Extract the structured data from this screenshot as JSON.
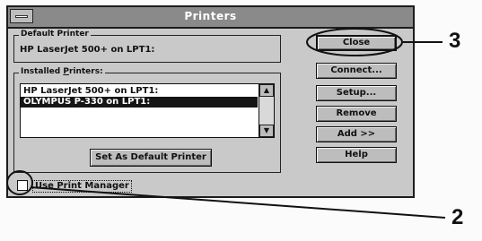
{
  "window": {
    "title": "Printers"
  },
  "default_printer": {
    "label": "Default Printer",
    "value": "HP LaserJet 500+ on LPT1:"
  },
  "installed_printers": {
    "label_prefix": "Installed ",
    "label_mnemonic": "P",
    "label_suffix": "rinters:",
    "items": [
      "HP LaserJet 500+ on LPT1:",
      "OLYMPUS P-330 on LPT1:"
    ],
    "selected_index": 1
  },
  "buttons": {
    "close": "Close",
    "connect": "Connect...",
    "setup": "Setup...",
    "remove": "Remove",
    "add": "Add >>",
    "help": "Help",
    "set_default": "Set As Default Printer"
  },
  "use_print_manager": {
    "label": "Use Print Manager",
    "checked": false
  },
  "callouts": {
    "three": "3",
    "two": "2"
  }
}
